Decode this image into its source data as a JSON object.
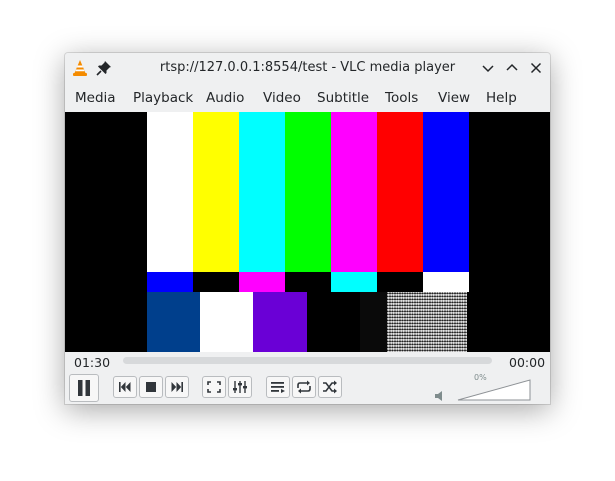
{
  "window": {
    "title": "rtsp://127.0.0.1:8554/test - VLC media player"
  },
  "menu": [
    "Media",
    "Playback",
    "Audio",
    "Video",
    "Subtitle",
    "Tools",
    "View",
    "Help"
  ],
  "video": {
    "test_pattern_top": [
      "#ffffff",
      "#ffff00",
      "#00ffff",
      "#00ff00",
      "#ff00ff",
      "#ff0000",
      "#0000ff"
    ],
    "test_pattern_mid": [
      "#0000ff",
      "#000000",
      "#ff00ff",
      "#000000",
      "#00ffff",
      "#000000",
      "#ffffff"
    ],
    "test_pattern_bottom": [
      "#003f8c",
      "#ffffff",
      "#6a00d6",
      "#000000",
      "#0a0a0a",
      "noise"
    ]
  },
  "seek": {
    "elapsed": "01:30",
    "remaining": "00:00",
    "progress": 0
  },
  "volume": {
    "label": "0%",
    "level": 0
  },
  "icons": {
    "app": "vlc-cone-icon",
    "pin": "pin-icon",
    "minimize": "chevron-down-icon",
    "maximize": "chevron-up-icon",
    "close": "close-icon",
    "pause": "pause-icon",
    "previous": "skip-previous-icon",
    "stop": "stop-icon",
    "next": "skip-next-icon",
    "fullscreen": "fullscreen-icon",
    "extended": "equalizer-icon",
    "playlist": "playlist-icon",
    "loop": "loop-icon",
    "shuffle": "shuffle-icon",
    "mute": "speaker-icon"
  },
  "colors": {
    "chrome": "#eff0f1",
    "text": "#232629",
    "vlc_orange": "#f48b00"
  }
}
